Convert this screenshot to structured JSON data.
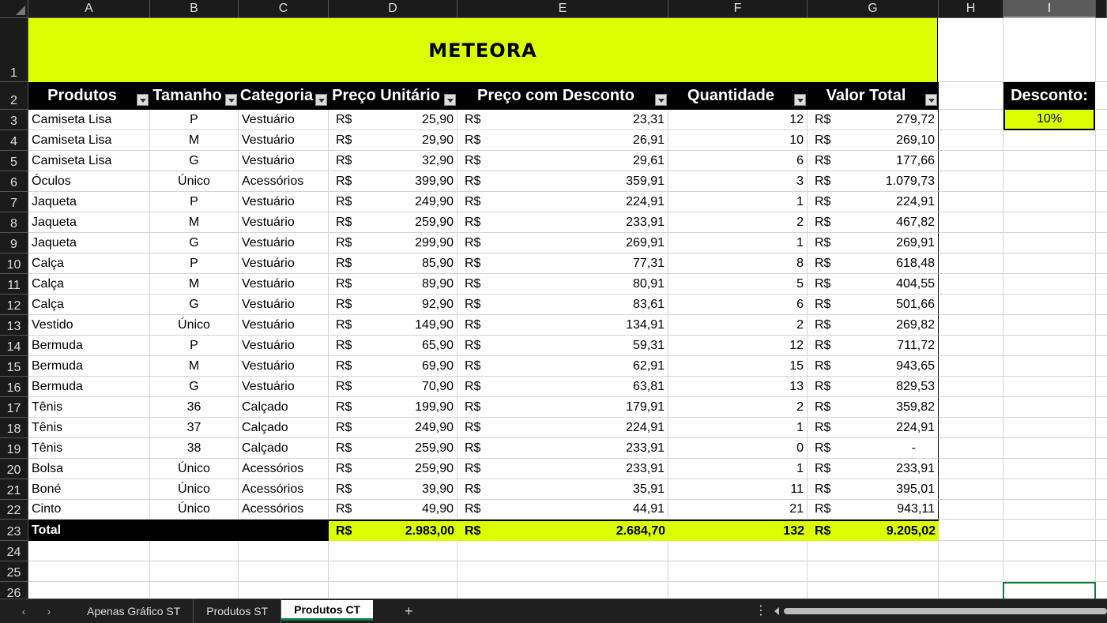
{
  "columns": [
    "A",
    "B",
    "C",
    "D",
    "E",
    "F",
    "G",
    "H",
    "I"
  ],
  "row_numbers": [
    "1",
    "2",
    "3",
    "4",
    "5",
    "6",
    "7",
    "8",
    "9",
    "10",
    "11",
    "12",
    "13",
    "14",
    "15",
    "16",
    "17",
    "18",
    "19",
    "20",
    "21",
    "22",
    "23",
    "24",
    "25",
    "26"
  ],
  "title": "METEORA",
  "headers": [
    "Produtos",
    "Tamanho",
    "Categoria",
    "Preço Unitário",
    "Preço com Desconto",
    "Quantidade",
    "Valor Total"
  ],
  "currency": "R$",
  "rows": [
    [
      "Camiseta Lisa",
      "P",
      "Vestuário",
      "25,90",
      "23,31",
      "12",
      "279,72"
    ],
    [
      "Camiseta Lisa",
      "M",
      "Vestuário",
      "29,90",
      "26,91",
      "10",
      "269,10"
    ],
    [
      "Camiseta Lisa",
      "G",
      "Vestuário",
      "32,90",
      "29,61",
      "6",
      "177,66"
    ],
    [
      "Óculos",
      "Único",
      "Acessórios",
      "399,90",
      "359,91",
      "3",
      "1.079,73"
    ],
    [
      "Jaqueta",
      "P",
      "Vestuário",
      "249,90",
      "224,91",
      "1",
      "224,91"
    ],
    [
      "Jaqueta",
      "M",
      "Vestuário",
      "259,90",
      "233,91",
      "2",
      "467,82"
    ],
    [
      "Jaqueta",
      "G",
      "Vestuário",
      "299,90",
      "269,91",
      "1",
      "269,91"
    ],
    [
      "Calça",
      "P",
      "Vestuário",
      "85,90",
      "77,31",
      "8",
      "618,48"
    ],
    [
      "Calça",
      "M",
      "Vestuário",
      "89,90",
      "80,91",
      "5",
      "404,55"
    ],
    [
      "Calça",
      "G",
      "Vestuário",
      "92,90",
      "83,61",
      "6",
      "501,66"
    ],
    [
      "Vestido",
      "Único",
      "Vestuário",
      "149,90",
      "134,91",
      "2",
      "269,82"
    ],
    [
      "Bermuda",
      "P",
      "Vestuário",
      "65,90",
      "59,31",
      "12",
      "711,72"
    ],
    [
      "Bermuda",
      "M",
      "Vestuário",
      "69,90",
      "62,91",
      "15",
      "943,65"
    ],
    [
      "Bermuda",
      "G",
      "Vestuário",
      "70,90",
      "63,81",
      "13",
      "829,53"
    ],
    [
      "Tênis",
      "36",
      "Calçado",
      "199,90",
      "179,91",
      "2",
      "359,82"
    ],
    [
      "Tênis",
      "37",
      "Calçado",
      "249,90",
      "224,91",
      "1",
      "224,91"
    ],
    [
      "Tênis",
      "38",
      "Calçado",
      "259,90",
      "233,91",
      "0",
      "-"
    ],
    [
      "Bolsa",
      "Único",
      "Acessórios",
      "259,90",
      "233,91",
      "1",
      "233,91"
    ],
    [
      "Boné",
      "Único",
      "Acessórios",
      "39,90",
      "35,91",
      "11",
      "395,01"
    ],
    [
      "Cinto",
      "Único",
      "Acessórios",
      "49,90",
      "44,91",
      "21",
      "943,11"
    ]
  ],
  "totals": {
    "label": "Total",
    "preco_unitario": "2.983,00",
    "preco_desconto": "2.684,70",
    "quantidade": "132",
    "valor_total": "9.205,02"
  },
  "discount": {
    "label": "Desconto:",
    "value": "10%"
  },
  "sheet_tabs": [
    "Apenas Gráfico ST",
    "Produtos ST",
    "Produtos CT"
  ],
  "active_tab": "Produtos CT",
  "colors": {
    "accent": "#dcff00",
    "header_bg": "#000000",
    "selection": "#107c41"
  }
}
